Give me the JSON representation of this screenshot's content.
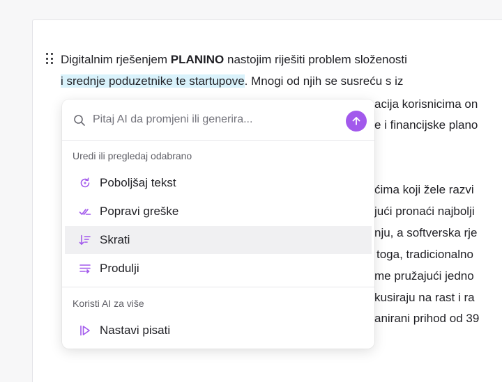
{
  "document": {
    "lines": [
      {
        "pre": "Digitalnim rješenjem ",
        "bold": "PLANINO",
        "post": " nastojim riješiti problem složenosti"
      },
      {
        "highlight": "i srednje poduzetnike te startupove",
        "post": ". Mnogi od njih se susreću s iz"
      },
      {
        "text": "acija korisnicima on"
      },
      {
        "text": "e i financijske plano"
      },
      {
        "text": "ćima koji žele razvi"
      },
      {
        "text": "jući pronaći najbolji"
      },
      {
        "text": "nju, a softverska rje"
      },
      {
        "text": "toga, tradicionalno"
      },
      {
        "text": "me pružajući jedno"
      },
      {
        "text": "kusiraju na rast i ra"
      },
      {
        "text": "anirani prihod od 39"
      }
    ]
  },
  "ai_popup": {
    "search": {
      "placeholder": "Pitaj AI da promjeni ili generira...",
      "value": ""
    },
    "sections": [
      {
        "label": "Uredi ili pregledaj odabrano",
        "items": [
          {
            "label": "Poboljšaj tekst",
            "icon": "sparkle-refresh-icon"
          },
          {
            "label": "Popravi greške",
            "icon": "double-check-icon"
          },
          {
            "label": "Skrati",
            "icon": "shorten-icon",
            "active": true
          },
          {
            "label": "Produlji",
            "icon": "lengthen-icon"
          }
        ]
      },
      {
        "label": "Koristi AI za više",
        "items": [
          {
            "label": "Nastavi pisati",
            "icon": "continue-writing-icon"
          }
        ]
      }
    ],
    "accent_color": "#a259ec"
  }
}
